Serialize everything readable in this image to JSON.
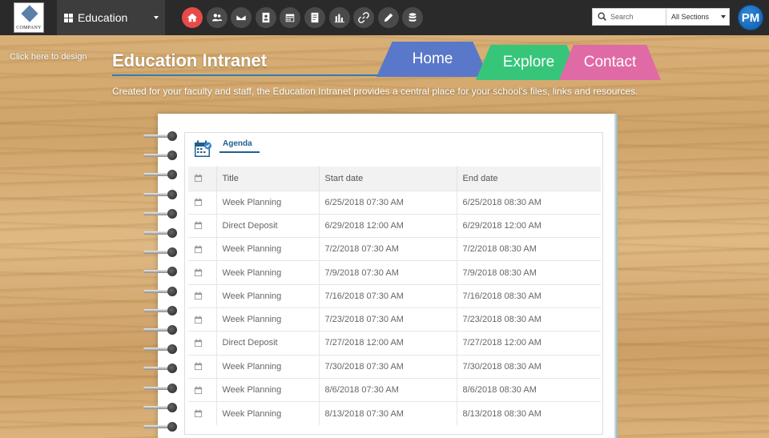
{
  "topbar": {
    "logo_text": "COMPANY",
    "site_name": "Education",
    "nav_icons": [
      "home-icon",
      "people-icon",
      "mail-icon",
      "contacts-icon",
      "calendar-icon",
      "documents-icon",
      "chart-icon",
      "link-icon",
      "pen-icon",
      "database-icon"
    ],
    "search_placeholder": "Search",
    "search_scope": "All Sections",
    "avatar_initials": "PM"
  },
  "header": {
    "design_link": "Click here to design",
    "title": "Education Intranet",
    "description": "Created for your faculty and staff, the Education Intranet provides a central place for your school's files, links and resources.",
    "tabs": [
      {
        "label": "Home",
        "color": "#5a78c9"
      },
      {
        "label": "Explore",
        "color": "#37c57a"
      },
      {
        "label": "Contact",
        "color": "#e06aa5"
      }
    ]
  },
  "agenda": {
    "tab_label": "Agenda",
    "columns": [
      "Title",
      "Start date",
      "End date"
    ],
    "rows": [
      {
        "title": "Week Planning",
        "start": "6/25/2018 07:30 AM",
        "end": "6/25/2018 08:30 AM"
      },
      {
        "title": "Direct Deposit",
        "start": "6/29/2018 12:00 AM",
        "end": "6/29/2018 12:00 AM"
      },
      {
        "title": "Week Planning",
        "start": "7/2/2018 07:30 AM",
        "end": "7/2/2018 08:30 AM"
      },
      {
        "title": "Week Planning",
        "start": "7/9/2018 07:30 AM",
        "end": "7/9/2018 08:30 AM"
      },
      {
        "title": "Week Planning",
        "start": "7/16/2018 07:30 AM",
        "end": "7/16/2018 08:30 AM"
      },
      {
        "title": "Week Planning",
        "start": "7/23/2018 07:30 AM",
        "end": "7/23/2018 08:30 AM"
      },
      {
        "title": "Direct Deposit",
        "start": "7/27/2018 12:00 AM",
        "end": "7/27/2018 12:00 AM"
      },
      {
        "title": "Week Planning",
        "start": "7/30/2018 07:30 AM",
        "end": "7/30/2018 08:30 AM"
      },
      {
        "title": "Week Planning",
        "start": "8/6/2018 07:30 AM",
        "end": "8/6/2018 08:30 AM"
      },
      {
        "title": "Week Planning",
        "start": "8/13/2018 07:30 AM",
        "end": "8/13/2018 08:30 AM"
      }
    ]
  }
}
